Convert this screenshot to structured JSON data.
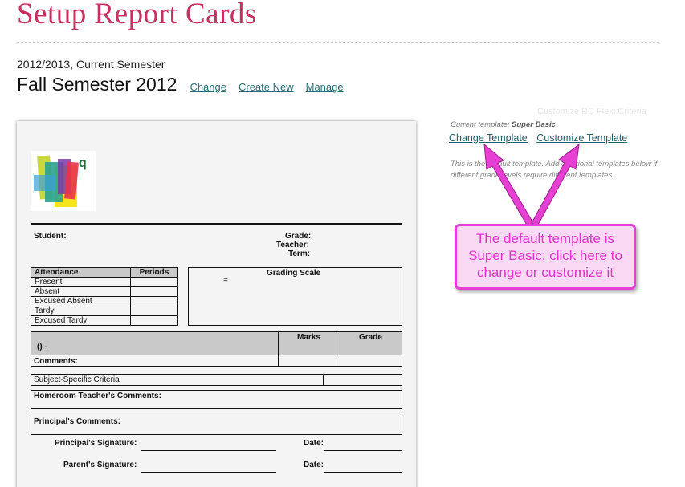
{
  "page": {
    "title": "Setup Report Cards",
    "year_line": "2012/2013, Current Semester",
    "semester_name": "Fall Semester 2012",
    "semester_links": [
      "Change",
      "Create New",
      "Manage"
    ],
    "faint_link": "Customize RC Flexi Criteria"
  },
  "template_panel": {
    "current_prefix": "Current template: ",
    "current_name": "Super Basic",
    "change_label": "Change Template",
    "customize_label": "Customize Template",
    "note": "This is the default template. Add additional templates below if different grade levels require different templates."
  },
  "callout": {
    "text": "The default template is Super Basic; click here to change or customize it",
    "color": "#e63fd3"
  },
  "report_card": {
    "logo_letter": "q",
    "student_label": "Student:",
    "grade_label": "Grade:",
    "teacher_label": "Teacher:",
    "term_label": "Term:",
    "attendance_header": "Attendance",
    "periods_header": "Periods",
    "attendance_rows": [
      "Present",
      "Absent",
      "Excused Absent",
      "Tardy",
      "Excused Tardy"
    ],
    "grading_scale_label": "Grading Scale",
    "grading_scale_value": "=",
    "marks_header": "Marks",
    "grade_header": "Grade",
    "subject_placeholder": "()  -",
    "comments_label": "Comments:",
    "subject_criteria_label": "Subject-Specific Criteria",
    "homeroom_label": "Homeroom Teacher's Comments:",
    "principal_comments_label": "Principal's Comments:",
    "principal_signature_label": "Principal's Signature:",
    "parent_signature_label": "Parent's Signature:",
    "date_label": "Date:"
  }
}
